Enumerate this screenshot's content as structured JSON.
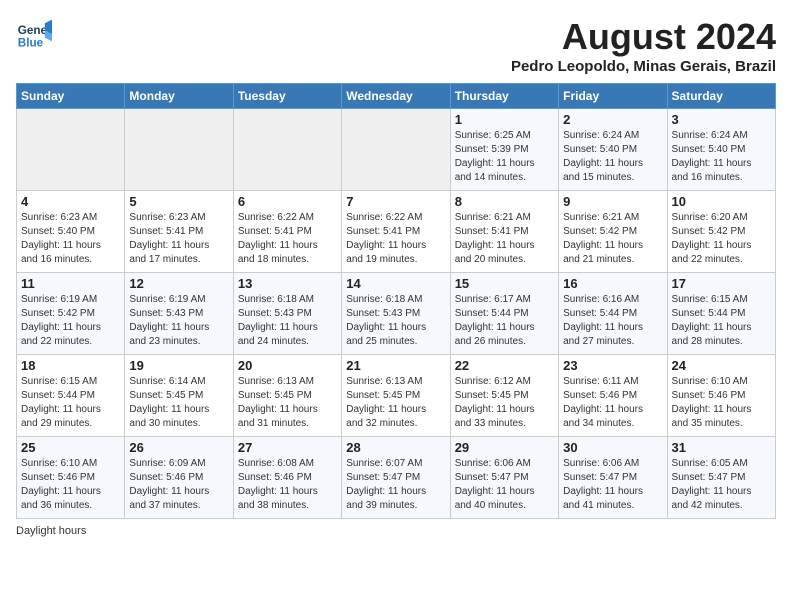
{
  "logo": {
    "line1": "General",
    "line2": "Blue"
  },
  "title": "August 2024",
  "location": "Pedro Leopoldo, Minas Gerais, Brazil",
  "days_of_week": [
    "Sunday",
    "Monday",
    "Tuesday",
    "Wednesday",
    "Thursday",
    "Friday",
    "Saturday"
  ],
  "weeks": [
    [
      {
        "day": "",
        "info": ""
      },
      {
        "day": "",
        "info": ""
      },
      {
        "day": "",
        "info": ""
      },
      {
        "day": "",
        "info": ""
      },
      {
        "day": "1",
        "info": "Sunrise: 6:25 AM\nSunset: 5:39 PM\nDaylight: 11 hours\nand 14 minutes."
      },
      {
        "day": "2",
        "info": "Sunrise: 6:24 AM\nSunset: 5:40 PM\nDaylight: 11 hours\nand 15 minutes."
      },
      {
        "day": "3",
        "info": "Sunrise: 6:24 AM\nSunset: 5:40 PM\nDaylight: 11 hours\nand 16 minutes."
      }
    ],
    [
      {
        "day": "4",
        "info": "Sunrise: 6:23 AM\nSunset: 5:40 PM\nDaylight: 11 hours\nand 16 minutes."
      },
      {
        "day": "5",
        "info": "Sunrise: 6:23 AM\nSunset: 5:41 PM\nDaylight: 11 hours\nand 17 minutes."
      },
      {
        "day": "6",
        "info": "Sunrise: 6:22 AM\nSunset: 5:41 PM\nDaylight: 11 hours\nand 18 minutes."
      },
      {
        "day": "7",
        "info": "Sunrise: 6:22 AM\nSunset: 5:41 PM\nDaylight: 11 hours\nand 19 minutes."
      },
      {
        "day": "8",
        "info": "Sunrise: 6:21 AM\nSunset: 5:41 PM\nDaylight: 11 hours\nand 20 minutes."
      },
      {
        "day": "9",
        "info": "Sunrise: 6:21 AM\nSunset: 5:42 PM\nDaylight: 11 hours\nand 21 minutes."
      },
      {
        "day": "10",
        "info": "Sunrise: 6:20 AM\nSunset: 5:42 PM\nDaylight: 11 hours\nand 22 minutes."
      }
    ],
    [
      {
        "day": "11",
        "info": "Sunrise: 6:19 AM\nSunset: 5:42 PM\nDaylight: 11 hours\nand 22 minutes."
      },
      {
        "day": "12",
        "info": "Sunrise: 6:19 AM\nSunset: 5:43 PM\nDaylight: 11 hours\nand 23 minutes."
      },
      {
        "day": "13",
        "info": "Sunrise: 6:18 AM\nSunset: 5:43 PM\nDaylight: 11 hours\nand 24 minutes."
      },
      {
        "day": "14",
        "info": "Sunrise: 6:18 AM\nSunset: 5:43 PM\nDaylight: 11 hours\nand 25 minutes."
      },
      {
        "day": "15",
        "info": "Sunrise: 6:17 AM\nSunset: 5:44 PM\nDaylight: 11 hours\nand 26 minutes."
      },
      {
        "day": "16",
        "info": "Sunrise: 6:16 AM\nSunset: 5:44 PM\nDaylight: 11 hours\nand 27 minutes."
      },
      {
        "day": "17",
        "info": "Sunrise: 6:15 AM\nSunset: 5:44 PM\nDaylight: 11 hours\nand 28 minutes."
      }
    ],
    [
      {
        "day": "18",
        "info": "Sunrise: 6:15 AM\nSunset: 5:44 PM\nDaylight: 11 hours\nand 29 minutes."
      },
      {
        "day": "19",
        "info": "Sunrise: 6:14 AM\nSunset: 5:45 PM\nDaylight: 11 hours\nand 30 minutes."
      },
      {
        "day": "20",
        "info": "Sunrise: 6:13 AM\nSunset: 5:45 PM\nDaylight: 11 hours\nand 31 minutes."
      },
      {
        "day": "21",
        "info": "Sunrise: 6:13 AM\nSunset: 5:45 PM\nDaylight: 11 hours\nand 32 minutes."
      },
      {
        "day": "22",
        "info": "Sunrise: 6:12 AM\nSunset: 5:45 PM\nDaylight: 11 hours\nand 33 minutes."
      },
      {
        "day": "23",
        "info": "Sunrise: 6:11 AM\nSunset: 5:46 PM\nDaylight: 11 hours\nand 34 minutes."
      },
      {
        "day": "24",
        "info": "Sunrise: 6:10 AM\nSunset: 5:46 PM\nDaylight: 11 hours\nand 35 minutes."
      }
    ],
    [
      {
        "day": "25",
        "info": "Sunrise: 6:10 AM\nSunset: 5:46 PM\nDaylight: 11 hours\nand 36 minutes."
      },
      {
        "day": "26",
        "info": "Sunrise: 6:09 AM\nSunset: 5:46 PM\nDaylight: 11 hours\nand 37 minutes."
      },
      {
        "day": "27",
        "info": "Sunrise: 6:08 AM\nSunset: 5:46 PM\nDaylight: 11 hours\nand 38 minutes."
      },
      {
        "day": "28",
        "info": "Sunrise: 6:07 AM\nSunset: 5:47 PM\nDaylight: 11 hours\nand 39 minutes."
      },
      {
        "day": "29",
        "info": "Sunrise: 6:06 AM\nSunset: 5:47 PM\nDaylight: 11 hours\nand 40 minutes."
      },
      {
        "day": "30",
        "info": "Sunrise: 6:06 AM\nSunset: 5:47 PM\nDaylight: 11 hours\nand 41 minutes."
      },
      {
        "day": "31",
        "info": "Sunrise: 6:05 AM\nSunset: 5:47 PM\nDaylight: 11 hours\nand 42 minutes."
      }
    ]
  ],
  "footer": "Daylight hours"
}
